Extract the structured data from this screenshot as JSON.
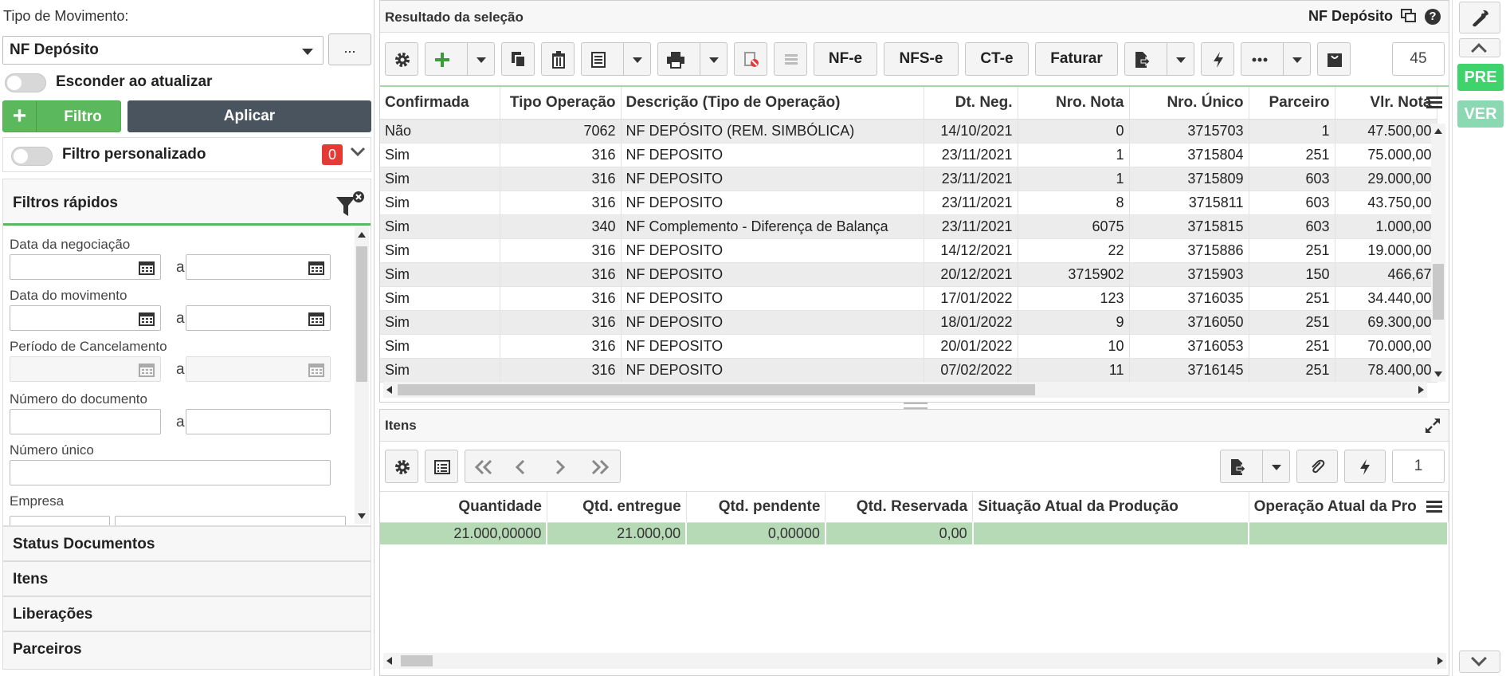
{
  "left": {
    "tipo_label": "Tipo de Movimento:",
    "tipo_value": "NF Depósito",
    "more_label": "...",
    "esconder_label": "Esconder ao atualizar",
    "filtro_button": "Filtro",
    "aplicar_button": "Aplicar",
    "filtro_personalizado_label": "Filtro personalizado",
    "filtro_personalizado_count": "0",
    "filtros_rapidos_title": "Filtros rápidos",
    "filters": {
      "data_negociacao": "Data da negociação",
      "data_movimento": "Data do movimento",
      "periodo_cancelamento": "Período de Cancelamento",
      "numero_documento": "Número do documento",
      "numero_unico": "Número único",
      "empresa": "Empresa",
      "a": "a"
    },
    "accordion": [
      "Status Documentos",
      "Itens",
      "Liberações",
      "Parceiros"
    ]
  },
  "top": {
    "title": "Resultado da seleção",
    "right_title": "NF Depósito",
    "help": "?",
    "toolbar": {
      "nfe": "NF-e",
      "nfse": "NFS-e",
      "cte": "CT-e",
      "faturar": "Faturar",
      "page": "45"
    },
    "columns": [
      "Confirmada",
      "Tipo Operação",
      "Descrição (Tipo de Operação)",
      "Dt. Neg.",
      "Nro. Nota",
      "Nro. Único",
      "Parceiro",
      "Vlr. Nota"
    ],
    "rows": [
      [
        "Não",
        "7062",
        "NF DEPÓSITO (REM. SIMBÓLICA)",
        "14/10/2021",
        "0",
        "3715703",
        "1",
        "47.500,00"
      ],
      [
        "Sim",
        "316",
        "NF DEPOSITO",
        "23/11/2021",
        "1",
        "3715804",
        "251",
        "75.000,00"
      ],
      [
        "Sim",
        "316",
        "NF DEPOSITO",
        "23/11/2021",
        "1",
        "3715809",
        "603",
        "29.000,00"
      ],
      [
        "Sim",
        "316",
        "NF DEPOSITO",
        "23/11/2021",
        "8",
        "3715811",
        "603",
        "43.750,00"
      ],
      [
        "Sim",
        "340",
        "NF Complemento - Diferença de Balança",
        "23/11/2021",
        "6075",
        "3715815",
        "603",
        "1.000,00"
      ],
      [
        "Sim",
        "316",
        "NF DEPOSITO",
        "14/12/2021",
        "22",
        "3715886",
        "251",
        "19.000,00"
      ],
      [
        "Sim",
        "316",
        "NF DEPOSITO",
        "20/12/2021",
        "3715902",
        "3715903",
        "150",
        "466,67"
      ],
      [
        "Sim",
        "316",
        "NF DEPOSITO",
        "17/01/2022",
        "123",
        "3716035",
        "251",
        "34.440,00"
      ],
      [
        "Sim",
        "316",
        "NF DEPOSITO",
        "18/01/2022",
        "9",
        "3716050",
        "251",
        "69.300,00"
      ],
      [
        "Sim",
        "316",
        "NF DEPOSITO",
        "20/01/2022",
        "10",
        "3716053",
        "251",
        "70.000,00"
      ],
      [
        "Sim",
        "316",
        "NF DEPOSITO",
        "07/02/2022",
        "11",
        "3716145",
        "251",
        "78.400,00"
      ]
    ]
  },
  "itens": {
    "title": "Itens",
    "page": "1",
    "columns": [
      "Quantidade",
      "Qtd. entregue",
      "Qtd. pendente",
      "Qtd. Reservada",
      "Situação Atual da Produção",
      "Operação Atual da Pro"
    ],
    "rows": [
      [
        "21.000,00000",
        "21.000,00",
        "0,00000",
        "0,00",
        "",
        ""
      ]
    ]
  },
  "rail": {
    "pre": "PRE",
    "ver": "VER"
  },
  "colors": {
    "green": "#5cb85c",
    "dark_button": "#4a545e",
    "badge_red": "#e53935",
    "pre_green": "#3ed36b",
    "ver_green": "#8ad9b2",
    "row_selected": "#b6d9b6"
  }
}
